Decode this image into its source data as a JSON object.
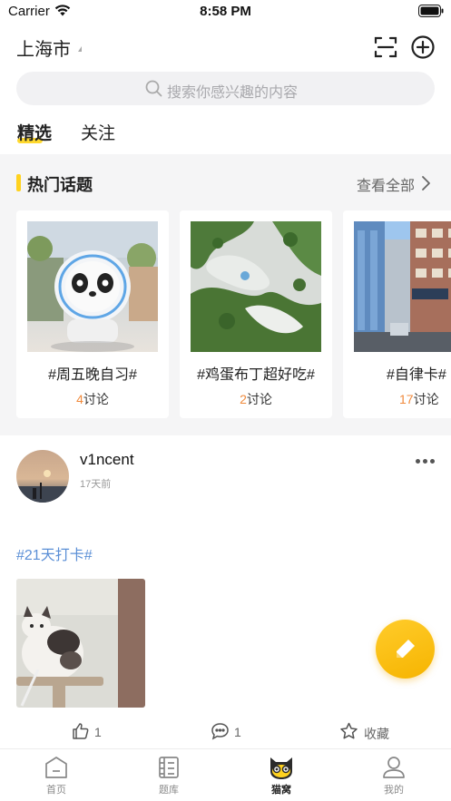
{
  "status_bar": {
    "carrier": "Carrier",
    "time": "8:58 PM"
  },
  "header": {
    "city": "上海市"
  },
  "search": {
    "placeholder": "搜索你感兴趣的内容"
  },
  "tabs": [
    {
      "label": "精选",
      "active": true
    },
    {
      "label": "关注",
      "active": false
    }
  ],
  "hot_topics": {
    "title": "热门话题",
    "view_all": "查看全部",
    "cards": [
      {
        "title": "#周五晚自习#",
        "count": "4",
        "suffix": "讨论"
      },
      {
        "title": "#鸡蛋布丁超好吃#",
        "count": "2",
        "suffix": "讨论"
      },
      {
        "title": "#自律卡#",
        "count": "17",
        "suffix": "讨论"
      }
    ]
  },
  "post": {
    "username": "v1ncent",
    "time": "17天前",
    "hashtag": "#21天打卡#",
    "likes": "1",
    "comments": "1",
    "favorite": "收藏"
  },
  "tabbar": {
    "items": [
      {
        "label": "首页",
        "icon": "home-icon",
        "active": false
      },
      {
        "label": "题库",
        "icon": "question-bank-icon",
        "active": false
      },
      {
        "label": "猫窝",
        "icon": "cat-icon",
        "active": true
      },
      {
        "label": "我的",
        "icon": "profile-icon",
        "active": false
      }
    ]
  },
  "colors": {
    "accent": "#ffd21f",
    "hashtag": "#5b8fd6",
    "count": "#f08a3c",
    "background_band": "#f5f5f6"
  }
}
